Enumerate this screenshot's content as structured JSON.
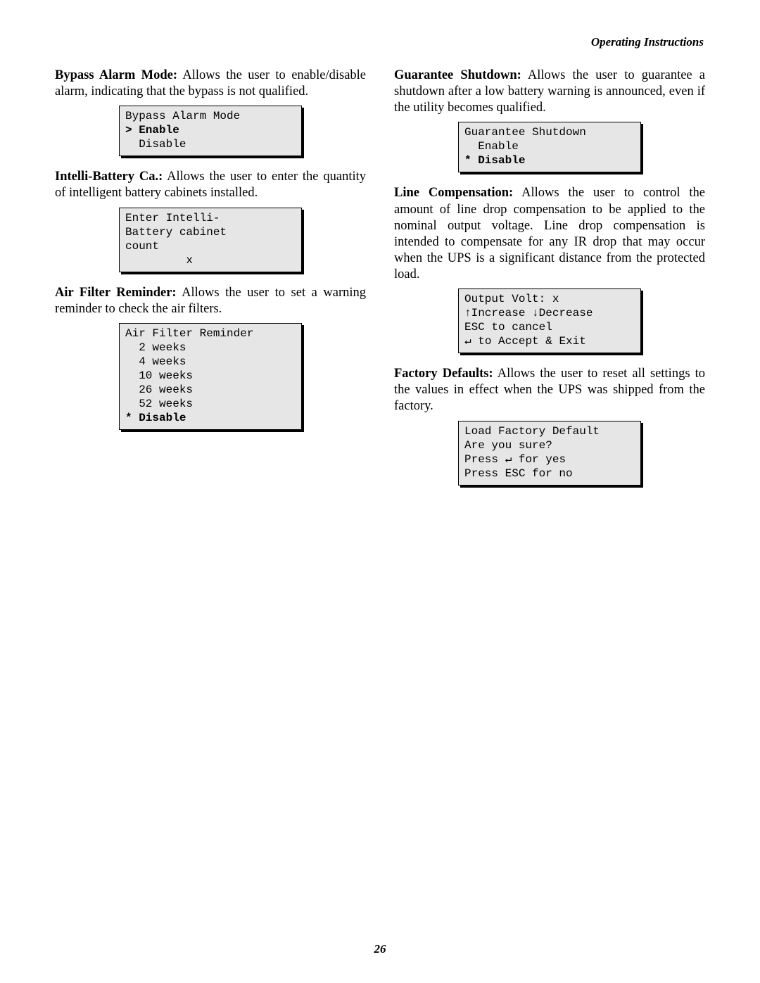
{
  "header": "Operating Instructions",
  "page_number": "26",
  "left": {
    "bypass": {
      "lead": "Bypass Alarm Mode:",
      "text": " Allows the user to enable/disable alarm, indicating that the bypass is not qualified.",
      "lcd_line1": "Bypass Alarm Mode",
      "lcd_line2": "> Enable",
      "lcd_line3": "  Disable"
    },
    "intelli": {
      "lead": "Intelli-Battery Ca.:",
      "text": " Allows the user to enter the quantity of intelligent battery cabinets installed.",
      "lcd_line1": "Enter Intelli-",
      "lcd_line2": "Battery cabinet",
      "lcd_line3": "count",
      "lcd_line4": "         x"
    },
    "airfilter": {
      "lead": "Air Filter Reminder:",
      "text": " Allows the user to set a warning reminder to check the air filters.",
      "lcd_line1": "Air Filter Reminder",
      "lcd_line2": "  2 weeks",
      "lcd_line3": "  4 weeks",
      "lcd_line4": "  10 weeks",
      "lcd_line5": "  26 weeks",
      "lcd_line6": "  52 weeks",
      "lcd_line7": "* Disable"
    }
  },
  "right": {
    "guarantee": {
      "lead": "Guarantee Shutdown:",
      "text": " Allows the user to guarantee a shutdown after a low battery warning is announced, even if the utility becomes qualified.",
      "lcd_line1": "Guarantee Shutdown",
      "lcd_line2": "  Enable",
      "lcd_line3": "* Disable"
    },
    "linecomp": {
      "lead": "Line Compensation:",
      "text": " Allows the user to control the amount of line drop compensation to be applied to the nominal output voltage. Line drop compensation is intended to compensate for any IR drop that may occur when the UPS is a significant distance from the protected load.",
      "lcd_line1": "Output Volt: x",
      "lcd_line2": "↑Increase ↓Decrease",
      "lcd_line3": "ESC to cancel",
      "lcd_line4": "↵ to Accept & Exit"
    },
    "factory": {
      "lead": "Factory Defaults:",
      "text": " Allows the user to reset all settings to the values in effect when the UPS was shipped from the factory.",
      "lcd_line1": "Load Factory Default",
      "lcd_line2": "Are you sure?",
      "lcd_line3": "Press ↵ for yes",
      "lcd_line4": "Press ESC for no"
    }
  }
}
